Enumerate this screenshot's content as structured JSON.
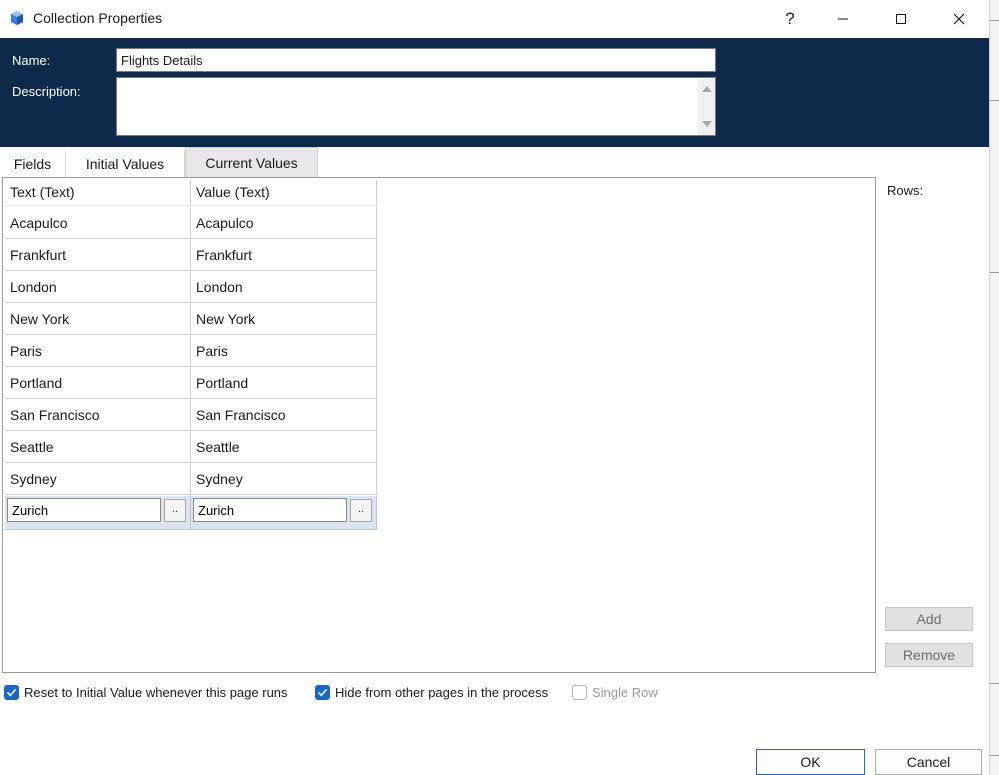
{
  "window": {
    "title": "Collection Properties",
    "help_glyph": "?",
    "min_glyph": "—",
    "max_glyph": "☐",
    "close_glyph": "✕",
    "icon": "collection-app-icon"
  },
  "header": {
    "name_label": "Name:",
    "name_value": "Flights Details",
    "description_label": "Description:",
    "description_value": ""
  },
  "tabs": [
    {
      "label": "Fields"
    },
    {
      "label": "Initial Values"
    },
    {
      "label": "Current Values",
      "active": true
    }
  ],
  "grid": {
    "columns": [
      "Text (Text)",
      "Value (Text)"
    ],
    "rows": [
      [
        "Acapulco",
        "Acapulco"
      ],
      [
        "Frankfurt",
        "Frankfurt"
      ],
      [
        "London",
        "London"
      ],
      [
        "New York",
        "New York"
      ],
      [
        "Paris",
        "Paris"
      ],
      [
        "Portland",
        "Portland"
      ],
      [
        "San Francisco",
        "San Francisco"
      ],
      [
        "Seattle",
        "Seattle"
      ],
      [
        "Sydney",
        "Sydney"
      ]
    ],
    "edit_row": [
      "Zurich",
      "Zurich"
    ],
    "ellipsis_label": ".."
  },
  "side": {
    "rows_label": "Rows:",
    "add_label": "Add",
    "remove_label": "Remove"
  },
  "options": {
    "reset_label": "Reset to Initial Value whenever this page runs",
    "reset_checked": true,
    "hide_label": "Hide from other pages in the process",
    "hide_checked": true,
    "single_row_label": "Single Row",
    "single_row_checked": false
  },
  "footer": {
    "ok_label": "OK",
    "cancel_label": "Cancel"
  },
  "colors": {
    "header_bg": "#0d2a4a",
    "checkbox_accent": "#1a66c6"
  }
}
